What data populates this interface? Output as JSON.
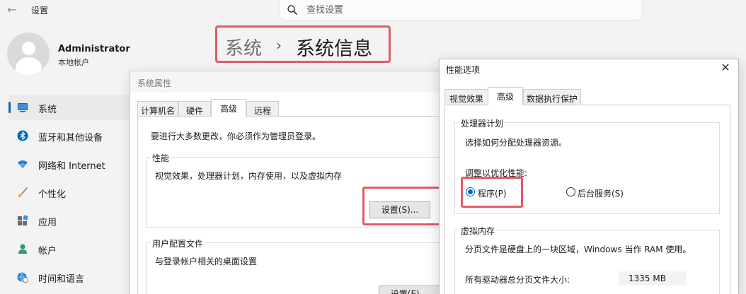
{
  "settings": {
    "title": "设置",
    "search": {
      "placeholder": "查找设置"
    },
    "user": {
      "name": "Administrator",
      "type": "本地帐户"
    },
    "nav": [
      {
        "label": "系统",
        "icon": "monitor-icon",
        "active": true
      },
      {
        "label": "蓝牙和其他设备",
        "icon": "bluetooth-icon"
      },
      {
        "label": "网络和 Internet",
        "icon": "wifi-icon"
      },
      {
        "label": "个性化",
        "icon": "brush-icon"
      },
      {
        "label": "应用",
        "icon": "apps-icon"
      },
      {
        "label": "帐户",
        "icon": "person-icon"
      },
      {
        "label": "时间和语言",
        "icon": "globe-clock-icon"
      }
    ],
    "breadcrumb": {
      "parent": "系统",
      "separator": "›",
      "current": "系统信息"
    }
  },
  "system_properties": {
    "title": "系统属性",
    "tabs": [
      "计算机名",
      "硬件",
      "高级",
      "远程"
    ],
    "active_tab": "高级",
    "admin_note": "要进行大多数更改，你必须作为管理员登录。",
    "performance": {
      "title": "性能",
      "description": "视觉效果，处理器计划，内存使用，以及虚拟内存",
      "button": "设置(S)..."
    },
    "user_profiles": {
      "title": "用户配置文件",
      "description": "与登录帐户相关的桌面设置",
      "button": "设置(E)..."
    }
  },
  "performance_options": {
    "title": "性能选项",
    "tabs": [
      "视觉效果",
      "高级",
      "数据执行保护"
    ],
    "active_tab": "高级",
    "processor_scheduling": {
      "title": "处理器计划",
      "description": "选择如何分配处理器资源。",
      "adjust_label": "调整以优化性能:",
      "options": [
        {
          "label": "程序(P)",
          "checked": true
        },
        {
          "label": "后台服务(S)",
          "checked": false
        }
      ]
    },
    "virtual_memory": {
      "title": "虚拟内存",
      "description": "分页文件是硬盘上的一块区域，Windows 当作 RAM 使用。",
      "total_label": "所有驱动器总分页文件大小:",
      "total_value": "1335 MB"
    }
  },
  "colors": {
    "highlight": "#e35a66",
    "accent": "#0067c0"
  }
}
